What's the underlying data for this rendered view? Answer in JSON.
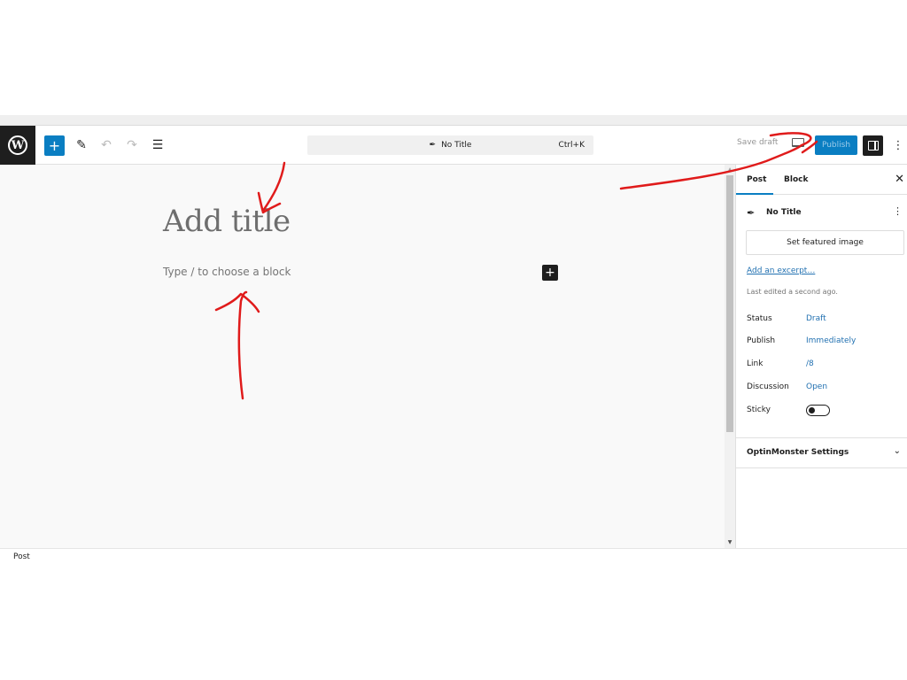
{
  "header": {
    "logo": "W",
    "add_block_icon": "+",
    "tools_icon": "✎",
    "undo_icon": "↶",
    "redo_icon": "↷",
    "outline_icon": "☰",
    "command_bar": {
      "icon": "✒",
      "title": "No Title",
      "shortcut": "Ctrl+K"
    },
    "save_draft": "Save draft",
    "publish": "Publish",
    "more_icon": "⋮"
  },
  "canvas": {
    "title_placeholder": "Add title",
    "block_placeholder": "Type / to choose a block",
    "inline_add_icon": "+"
  },
  "sidebar": {
    "tabs": [
      {
        "label": "Post",
        "active": true
      },
      {
        "label": "Block",
        "active": false
      }
    ],
    "close_icon": "✕",
    "post_title": "No Title",
    "post_icon": "✒",
    "kebab_icon": "⋮",
    "featured_image": "Set featured image",
    "excerpt_link": "Add an excerpt…",
    "last_edited": "Last edited a second ago.",
    "properties": [
      {
        "label": "Status",
        "value": "Draft"
      },
      {
        "label": "Publish",
        "value": "Immediately"
      },
      {
        "label": "Link",
        "value": "/8"
      },
      {
        "label": "Discussion",
        "value": "Open"
      }
    ],
    "sticky": {
      "label": "Sticky",
      "checked": false
    },
    "optinmonster": {
      "label": "OptinMonster Settings",
      "chevron": "⌄"
    }
  },
  "scrollbar": {
    "up": "▲",
    "down": "▼"
  },
  "footer": {
    "breadcrumb": "Post"
  },
  "colors": {
    "accent": "#0a7ec2",
    "link": "#2271b1",
    "dark": "#1e1e1e",
    "annotation": "#e01b1b"
  }
}
